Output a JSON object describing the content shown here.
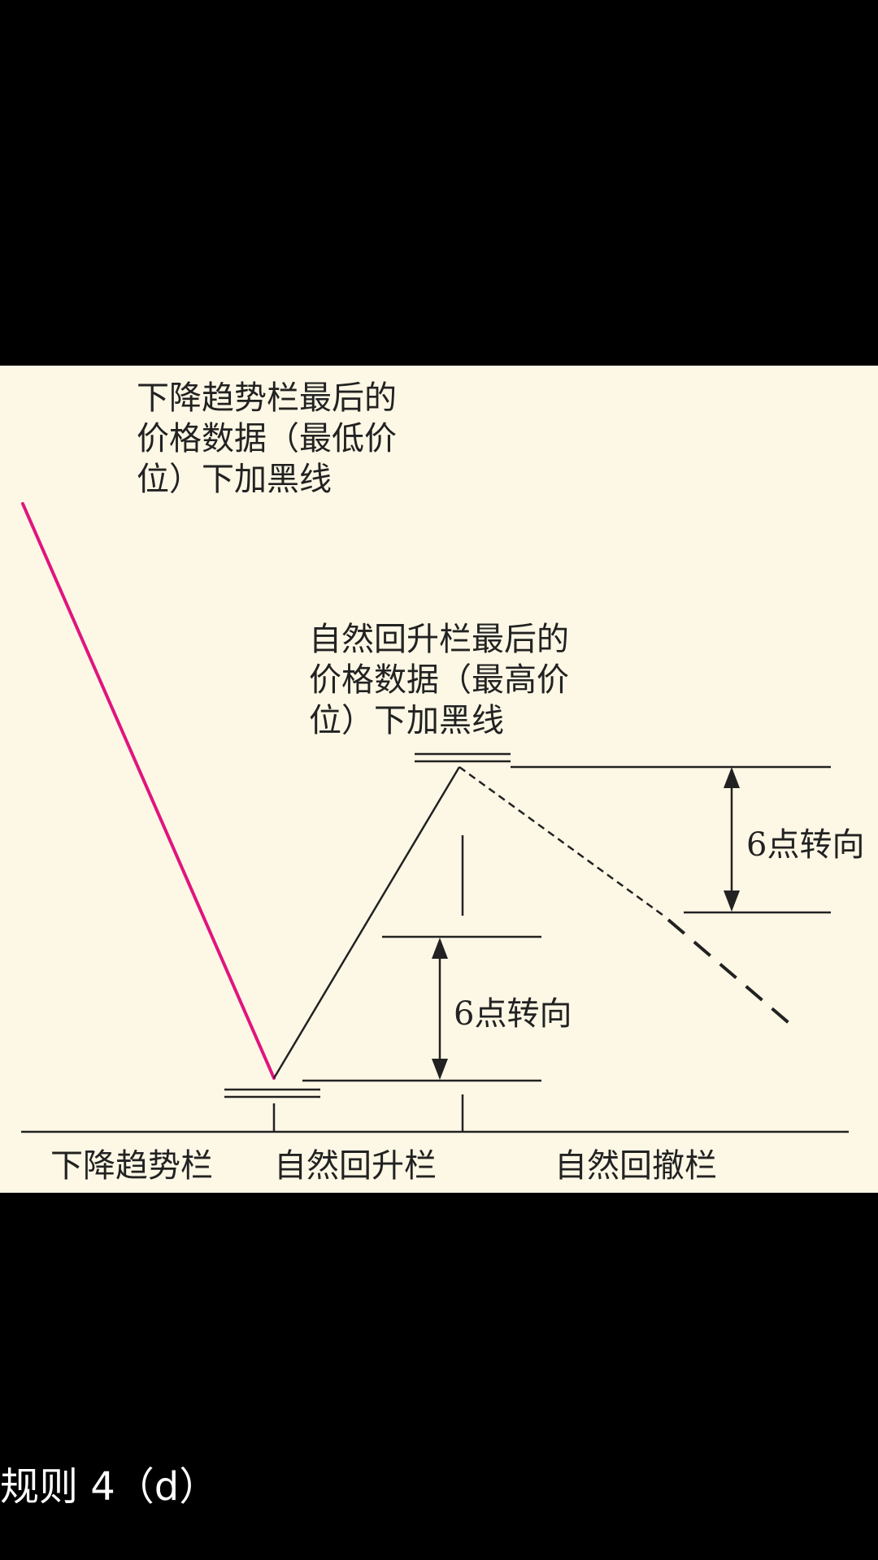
{
  "figure": {
    "annotations": {
      "downtrend_last_price": "下降趋势栏最后的\n价格数据（最低价\n位）下加黑线",
      "rally_last_price": "自然回升栏最后的\n价格数据（最高价\n位）下加黑线",
      "reversal_upper": "6点转向",
      "reversal_lower": "6点转向"
    },
    "columns": {
      "downtrend": "下降趋势栏",
      "natural_rally": "自然回升栏",
      "natural_reaction": "自然回撤栏"
    },
    "colors": {
      "background": "#fdf8e6",
      "downtrend_line": "#e0157f",
      "ink": "#222222"
    }
  },
  "caption": "规则 4（d）"
}
